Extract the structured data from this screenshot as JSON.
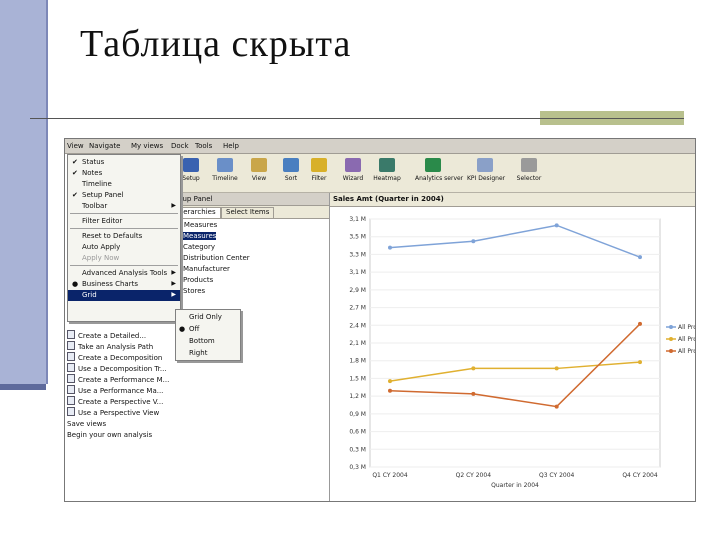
{
  "slide": {
    "title": "Таблица скрыта"
  },
  "menubar": [
    "View",
    "Navigate",
    "My views",
    "Dock",
    "Tools",
    "Help"
  ],
  "toolbar": {
    "buttons": [
      {
        "label": "Setup",
        "icon": "setup-icon",
        "color": "#3a62b0"
      },
      {
        "label": "Timeline",
        "icon": "timeline-icon",
        "color": "#6a8fc8"
      },
      {
        "label": "View",
        "icon": "view-icon",
        "color": "#c9a64a"
      },
      {
        "label": "Sort",
        "icon": "sort-icon",
        "color": "#4a7fc0"
      },
      {
        "label": "Filter",
        "icon": "filter-icon",
        "color": "#d8b02a"
      },
      {
        "label": "Wizard",
        "icon": "wizard-icon",
        "color": "#8a6ab0"
      },
      {
        "label": "Heatmap",
        "icon": "heatmap-icon",
        "color": "#3a7a6a"
      },
      {
        "label": "Analytics server",
        "icon": "analytics-server-icon",
        "color": "#2a8a4a"
      },
      {
        "label": "KPI Designer",
        "icon": "kpi-designer-icon",
        "color": "#8aa0c8"
      },
      {
        "label": "Selector",
        "icon": "selector-icon",
        "color": "#9a9a9a"
      }
    ]
  },
  "view_menu": {
    "items": [
      {
        "check": "✔",
        "label": "Status",
        "arrow": ""
      },
      {
        "check": "✔",
        "label": "Notes",
        "arrow": ""
      },
      {
        "check": "",
        "label": "Timeline",
        "arrow": ""
      },
      {
        "check": "✔",
        "label": "Setup Panel",
        "arrow": ""
      },
      {
        "check": "",
        "label": "Toolbar",
        "arrow": "▶"
      },
      {
        "check": "",
        "label": "Filter Editor",
        "arrow": ""
      },
      {
        "check": "",
        "label": "Reset to Defaults",
        "arrow": ""
      },
      {
        "check": "",
        "label": "Auto Apply",
        "arrow": ""
      },
      {
        "check": "",
        "label": "Apply Now",
        "arrow": ""
      },
      {
        "check": "",
        "label": "Advanced Analysis Tools",
        "arrow": "▶"
      },
      {
        "check": "●",
        "label": "Business Charts",
        "arrow": "▶"
      },
      {
        "check": "",
        "label": "Grid",
        "arrow": "▶"
      }
    ]
  },
  "grid_menu": {
    "items": [
      {
        "check": "",
        "label": "Grid Only"
      },
      {
        "check": "●",
        "label": "Off"
      },
      {
        "check": "",
        "label": "Bottom"
      },
      {
        "check": "",
        "label": "Right"
      }
    ]
  },
  "task_list": {
    "items": [
      "Create a Detailed...",
      "Take an Analysis Path",
      "Create a Decomposition",
      "Use a Decomposition Tr...",
      "Create a Performance M...",
      "Use a Performance Ma...",
      "Create a Perspective V...",
      "Use a Perspective View"
    ],
    "footer": [
      "Save views",
      "Begin your own analysis"
    ]
  },
  "setup_panel": {
    "title": "Setup Panel",
    "tabs": [
      "Hierarchies",
      "Select Items"
    ],
    "subheader": "All Measures",
    "tree": [
      "Measures",
      "Category",
      "Distribution Center",
      "Manufacturer",
      "Products",
      "Stores"
    ]
  },
  "chart_header": "Sales Amt (Quarter in 2004)",
  "chart_data": {
    "type": "line",
    "x": [
      "Q1 CY 2004",
      "Q2 CY 2004",
      "Q3 CY 2004",
      "Q4 CY 2004"
    ],
    "xlabel": "Quarter in 2004",
    "yticks": [
      "3,1 M",
      "3,5 M",
      "3,3 M",
      "3,1 M",
      "2,9 M",
      "2,7 M",
      "2,4 M",
      "2,1 M",
      "1,8 M",
      "1,5 M",
      "1,2 M",
      "0,9 M",
      "0,6 M",
      "0,3 M",
      "0,3 M"
    ],
    "ylim": [
      0,
      3.9
    ],
    "series": [
      {
        "name": "All Pro...",
        "color": "#7fa3d8",
        "values": [
          3.45,
          3.55,
          3.8,
          3.3
        ]
      },
      {
        "name": "All Pro...",
        "color": "#e0b030",
        "values": [
          1.35,
          1.55,
          1.55,
          1.65
        ]
      },
      {
        "name": "All Pro...",
        "color": "#d06a30",
        "values": [
          1.2,
          1.15,
          0.95,
          2.25
        ]
      }
    ]
  }
}
